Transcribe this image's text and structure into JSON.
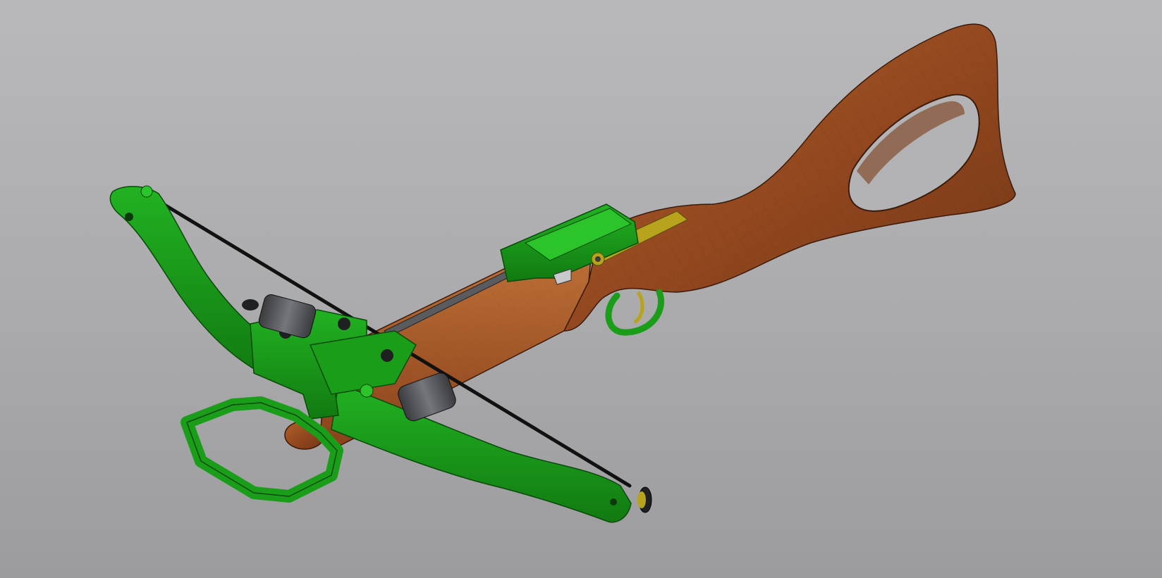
{
  "viewport": {
    "background_top": "#b9b9bb",
    "background_bottom": "#9c9c9f"
  },
  "model": {
    "parts": [
      {
        "part": "stock",
        "material": "wood",
        "color": "#9a4f24"
      },
      {
        "part": "bow-limbs",
        "material": "green",
        "color": "#1a9e1a"
      },
      {
        "part": "bowstring",
        "color": "#111111"
      },
      {
        "part": "trigger-guard",
        "color": "#1a9e1a"
      },
      {
        "part": "cocking-stirrup",
        "color": "#1a9e1a"
      },
      {
        "part": "limb-bolts",
        "color": "#55565a"
      },
      {
        "part": "brass-trim",
        "color": "#b7a31c"
      }
    ]
  }
}
